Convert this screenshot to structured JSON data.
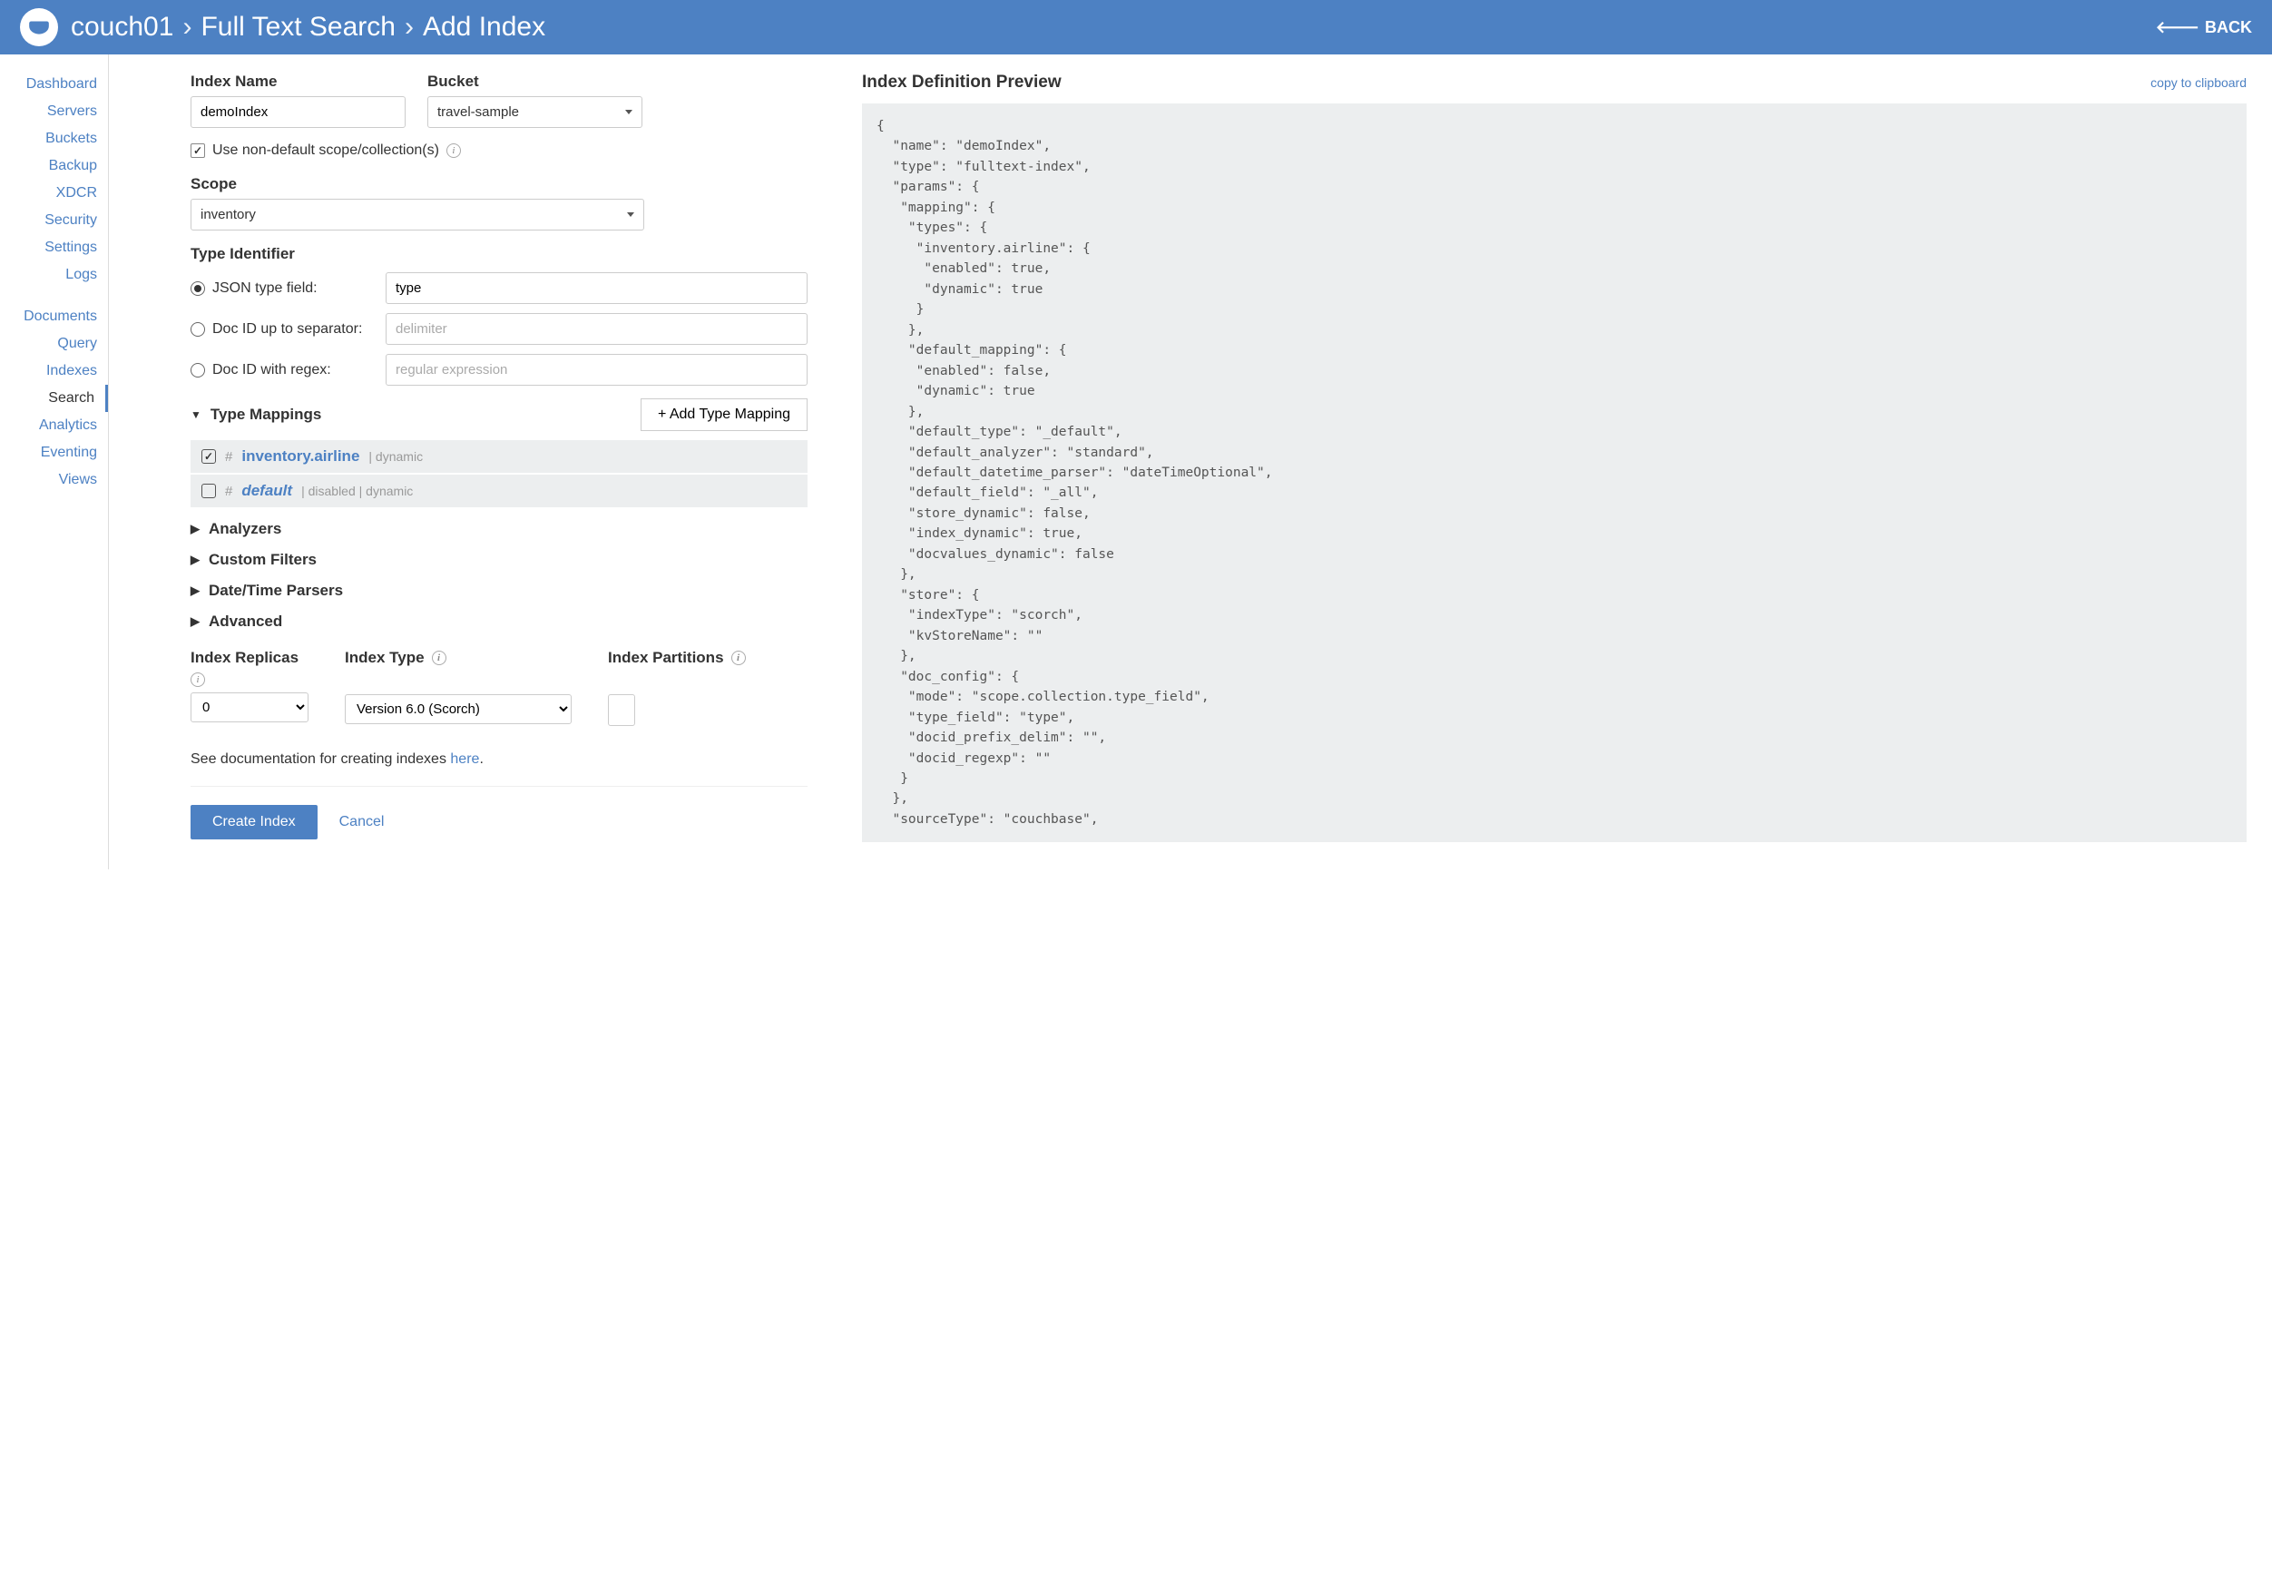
{
  "header": {
    "breadcrumb": [
      "couch01",
      "Full Text Search",
      "Add Index"
    ],
    "back": "BACK"
  },
  "sidebar": {
    "group1": [
      "Dashboard",
      "Servers",
      "Buckets",
      "Backup",
      "XDCR",
      "Security",
      "Settings",
      "Logs"
    ],
    "group2": [
      "Documents",
      "Query",
      "Indexes",
      "Search",
      "Analytics",
      "Eventing",
      "Views"
    ],
    "active": "Search"
  },
  "form": {
    "index_name_label": "Index Name",
    "index_name_value": "demoIndex",
    "bucket_label": "Bucket",
    "bucket_value": "travel-sample",
    "use_nondefault_label": "Use non-default scope/collection(s)",
    "use_nondefault_checked": true,
    "scope_label": "Scope",
    "scope_value": "inventory",
    "type_identifier_label": "Type Identifier",
    "radios": {
      "json_type": {
        "label": "JSON type field:",
        "value": "type",
        "selected": true
      },
      "docid_sep": {
        "label": "Doc ID up to separator:",
        "placeholder": "delimiter",
        "selected": false
      },
      "docid_regex": {
        "label": "Doc ID with regex:",
        "placeholder": "regular expression",
        "selected": false
      }
    },
    "type_mappings_label": "Type Mappings",
    "add_mapping_btn": "+ Add Type Mapping",
    "mappings": [
      {
        "checked": true,
        "name": "inventory.airline",
        "tags": "| dynamic",
        "default": false
      },
      {
        "checked": false,
        "name": "default",
        "tags": "| disabled | dynamic",
        "default": true
      }
    ],
    "collapsed": [
      "Analyzers",
      "Custom Filters",
      "Date/Time Parsers",
      "Advanced"
    ],
    "index_replicas_label": "Index Replicas",
    "index_replicas_value": "0",
    "index_type_label": "Index Type",
    "index_type_value": "Version 6.0 (Scorch)",
    "index_partitions_label": "Index Partitions",
    "index_partitions_value": "",
    "doc_text_pre": "See documentation for creating indexes ",
    "doc_link": "here",
    "create_btn": "Create Index",
    "cancel_btn": "Cancel"
  },
  "preview": {
    "title": "Index Definition Preview",
    "copy": "copy to clipboard",
    "json": "{\n  \"name\": \"demoIndex\",\n  \"type\": \"fulltext-index\",\n  \"params\": {\n   \"mapping\": {\n    \"types\": {\n     \"inventory.airline\": {\n      \"enabled\": true,\n      \"dynamic\": true\n     }\n    },\n    \"default_mapping\": {\n     \"enabled\": false,\n     \"dynamic\": true\n    },\n    \"default_type\": \"_default\",\n    \"default_analyzer\": \"standard\",\n    \"default_datetime_parser\": \"dateTimeOptional\",\n    \"default_field\": \"_all\",\n    \"store_dynamic\": false,\n    \"index_dynamic\": true,\n    \"docvalues_dynamic\": false\n   },\n   \"store\": {\n    \"indexType\": \"scorch\",\n    \"kvStoreName\": \"\"\n   },\n   \"doc_config\": {\n    \"mode\": \"scope.collection.type_field\",\n    \"type_field\": \"type\",\n    \"docid_prefix_delim\": \"\",\n    \"docid_regexp\": \"\"\n   }\n  },\n  \"sourceType\": \"couchbase\","
  }
}
